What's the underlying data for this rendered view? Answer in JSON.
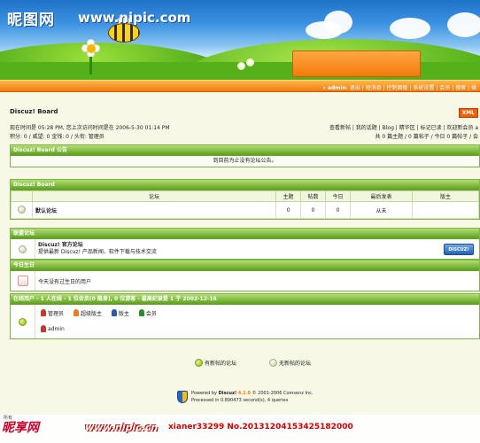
{
  "watermark": {
    "logo": "昵图网",
    "url": "www.nipic.com",
    "bottom_logo": "昵享网",
    "bottom_url": "www.nipic.cn",
    "bottom_id": "xianer33299 No.20131204153425182000",
    "small": "所有"
  },
  "nav": {
    "user_prefix": "»",
    "username": "admin",
    "links": [
      "退出",
      "短消息",
      "控制面板",
      "系统设置",
      "会员",
      "搜索",
      "插"
    ]
  },
  "board": {
    "title": "Discuz! Board",
    "xml_label": "XML",
    "visit_line": "现在时间是 05:28 PM, 您上次访问时间是在 2006-5-30 01:14 PM",
    "points_line": "积分: 0 / 威望: 0 金钱: 0 / 头衔: 管理员",
    "quick_links": "查看新帖 | 我的话题 | Blog | 精华区 | 标记已读 | 欢迎新会员 a",
    "stats_line": "共 0 篇主题 / 0 篇帖子 / 今日 0 篇帖子 / 会"
  },
  "announcement": {
    "header": "Discuz! Board 公告",
    "text": "到目前为止没有论坛公告。"
  },
  "forum_table": {
    "header": "Discuz! Board",
    "columns": [
      "论坛",
      "主题",
      "帖数",
      "今日",
      "最后发表",
      "版主"
    ],
    "rows": [
      {
        "name": "默认论坛",
        "topics": "0",
        "posts": "0",
        "today": "0",
        "last": "从未",
        "mod": ""
      }
    ]
  },
  "partner": {
    "header": "联盟论坛",
    "name": "Discuz! 官方论坛",
    "desc": "提供最新 Discuz! 产品新闻、软件下载与技术交流",
    "badge": "DISCUZ!"
  },
  "birthday": {
    "header": "今日生日",
    "text": "今天没有过生日的用户"
  },
  "online": {
    "header": "在线用户 - 1 人在线 - 1 位会员(0 隐身), 0 位游客 - 最高纪录是 1 于 2002-12-16",
    "legend": [
      "管理员",
      "超级版主",
      "版主",
      "会员"
    ],
    "users": [
      "admin"
    ],
    "colors": {
      "admin": "#c0392b",
      "super": "#e67e22",
      "mod": "#2c5aa0",
      "member": "#2e8b2e"
    }
  },
  "legend_footer": {
    "new": "有新帖的论坛",
    "nonew": "无新帖的论坛"
  },
  "powered": {
    "line1_prefix": "Powered by",
    "product": "Discuz!",
    "version": "4.1.0",
    "copyright": "© 2001-2006 Comsenz Inc.",
    "processed": "Processed in 0.890473 second(s), 4 queries"
  }
}
